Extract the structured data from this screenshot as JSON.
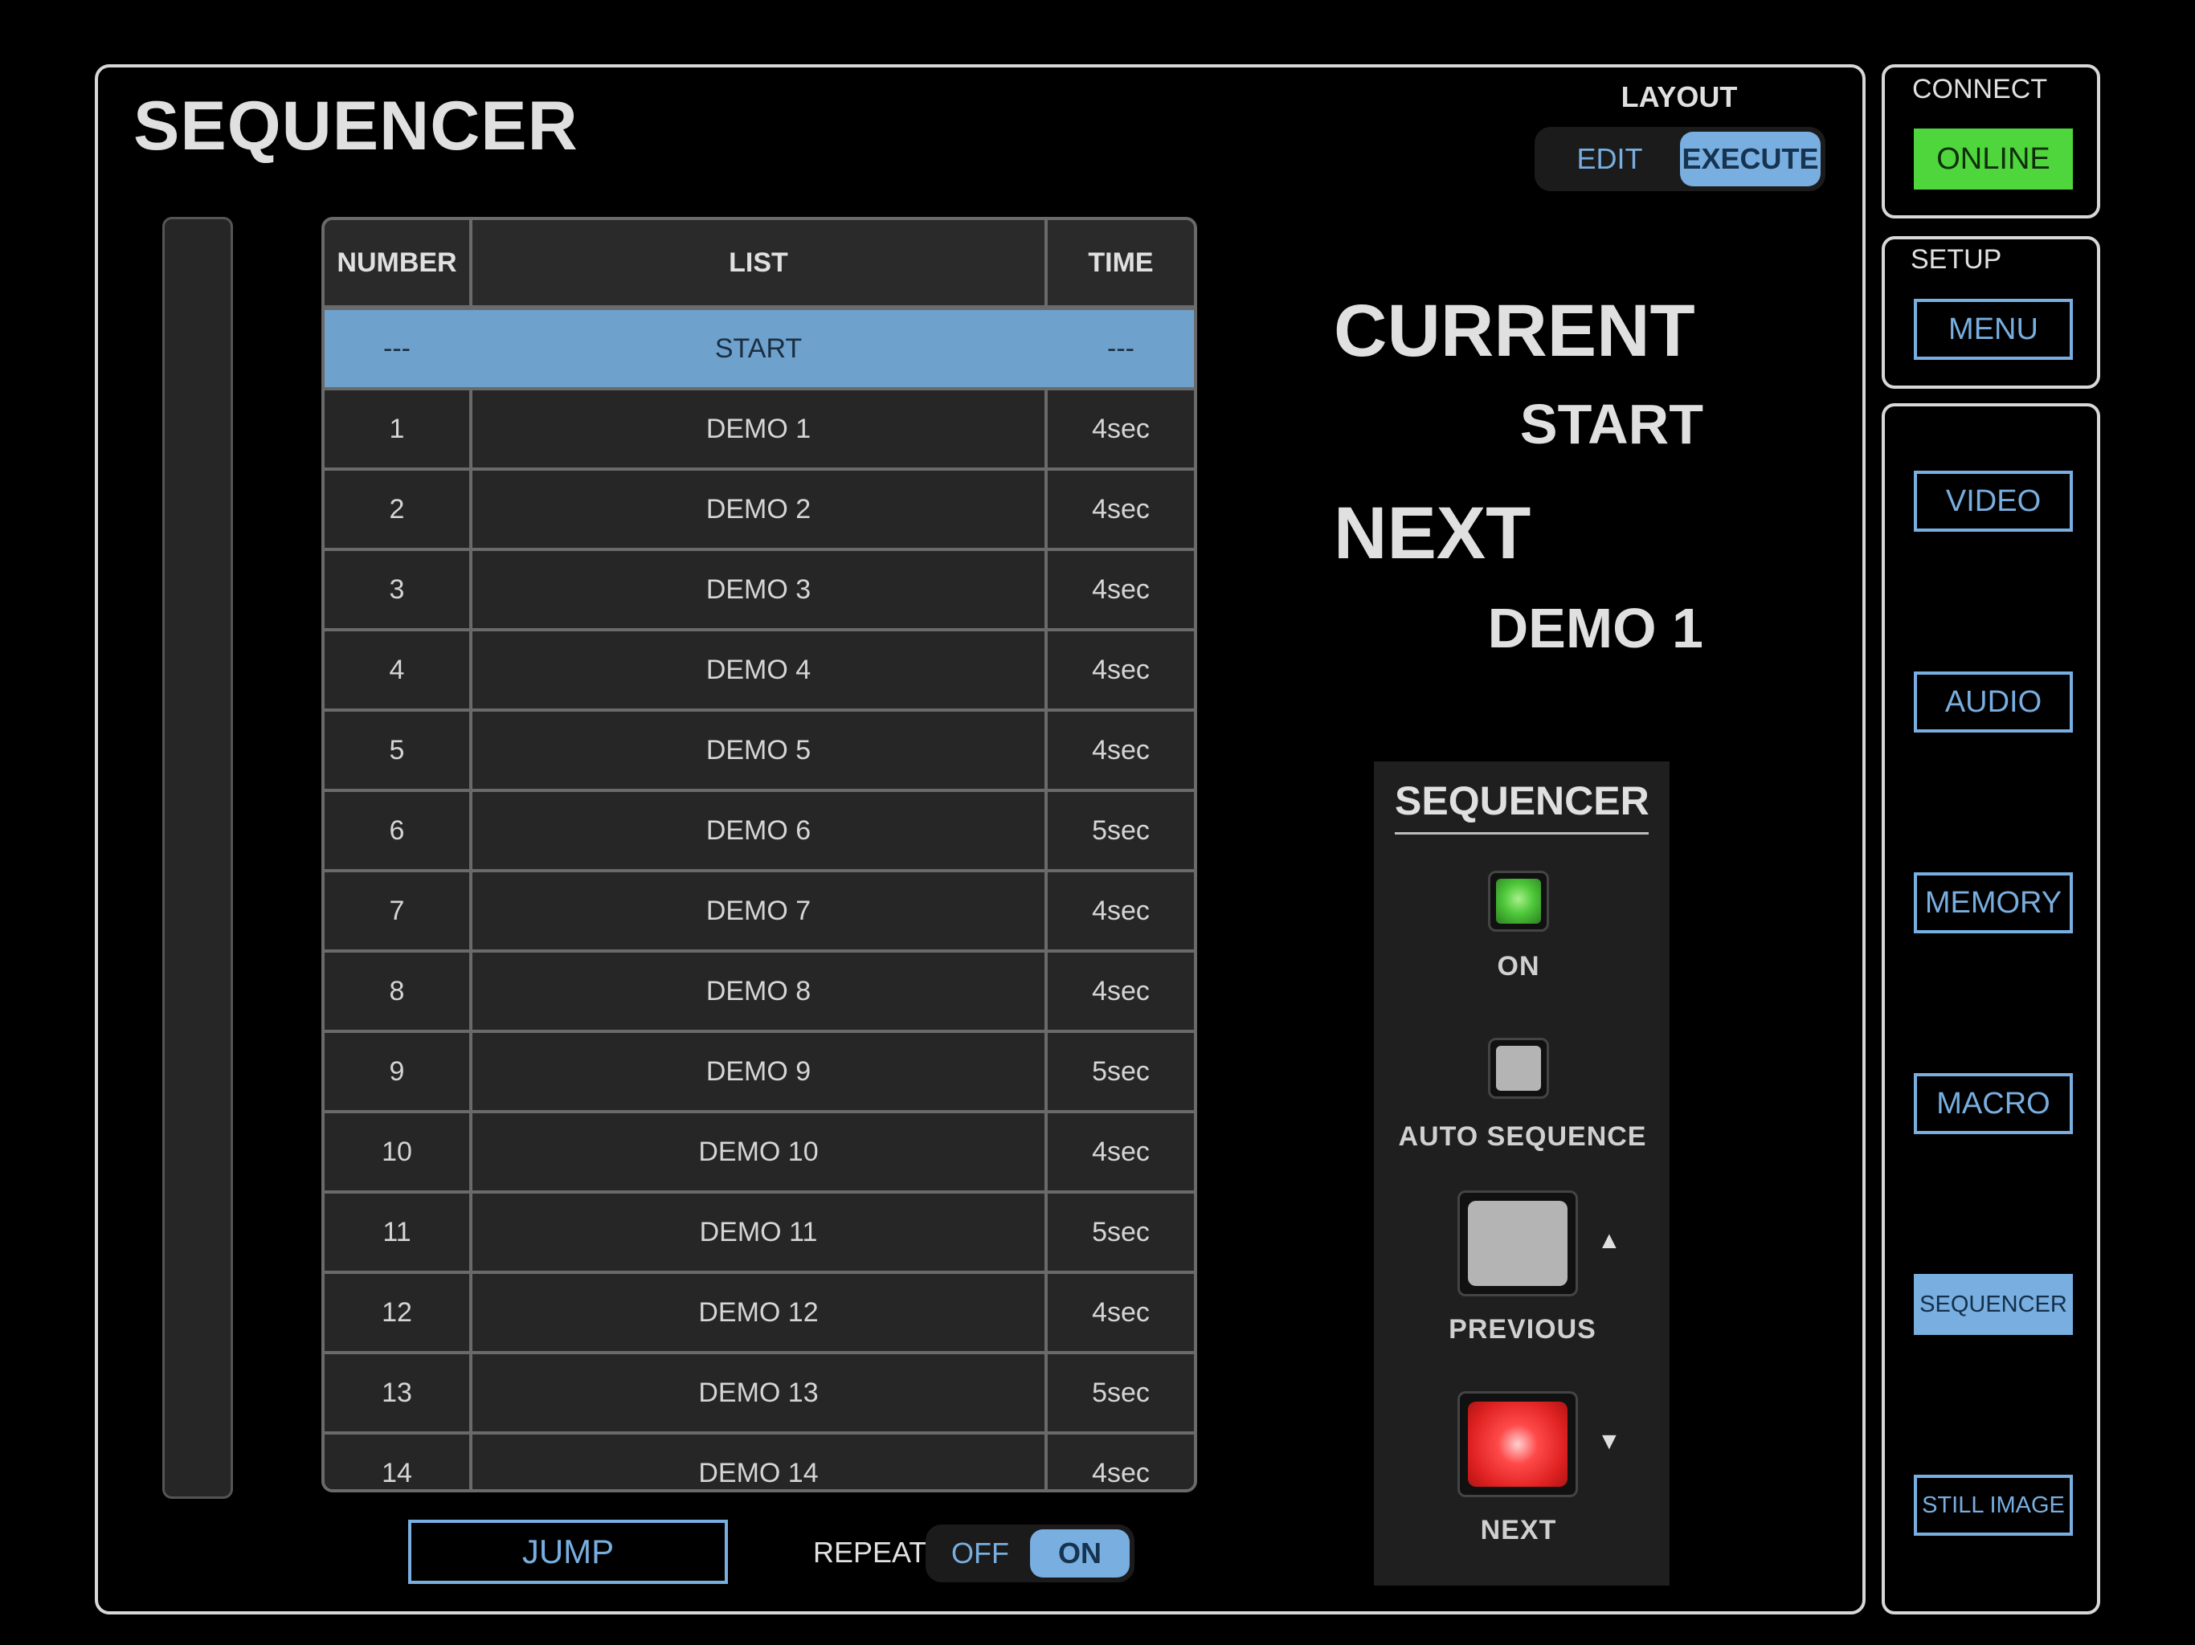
{
  "page_title": "SEQUENCER",
  "layout": {
    "label": "LAYOUT",
    "options": [
      "EDIT",
      "EXECUTE"
    ],
    "selected": "EXECUTE"
  },
  "table": {
    "columns": [
      "NUMBER",
      "LIST",
      "TIME"
    ],
    "rows": [
      [
        "---",
        "START",
        "---"
      ],
      [
        "1",
        "DEMO 1",
        "4sec"
      ],
      [
        "2",
        "DEMO 2",
        "4sec"
      ],
      [
        "3",
        "DEMO 3",
        "4sec"
      ],
      [
        "4",
        "DEMO 4",
        "4sec"
      ],
      [
        "5",
        "DEMO 5",
        "4sec"
      ],
      [
        "6",
        "DEMO 6",
        "5sec"
      ],
      [
        "7",
        "DEMO 7",
        "4sec"
      ],
      [
        "8",
        "DEMO 8",
        "4sec"
      ],
      [
        "9",
        "DEMO 9",
        "5sec"
      ],
      [
        "10",
        "DEMO 10",
        "4sec"
      ],
      [
        "11",
        "DEMO 11",
        "5sec"
      ],
      [
        "12",
        "DEMO 12",
        "4sec"
      ],
      [
        "13",
        "DEMO 13",
        "5sec"
      ],
      [
        "14",
        "DEMO 14",
        "4sec"
      ]
    ],
    "selected_row": 0
  },
  "jump_label": "JUMP",
  "repeat": {
    "label": "REPEAT",
    "options": [
      "OFF",
      "ON"
    ],
    "selected": "ON"
  },
  "current": {
    "heading": "CURRENT",
    "value": "START"
  },
  "next": {
    "heading": "NEXT",
    "value": "DEMO 1"
  },
  "sequencer_panel": {
    "title": "SEQUENCER",
    "on_label": "ON",
    "auto_label": "AUTO SEQUENCE",
    "previous_label": "PREVIOUS",
    "next_label": "NEXT",
    "previous_arrow": "▲",
    "next_arrow": "▼"
  },
  "sidebar": {
    "connect_label": "CONNECT",
    "online_label": "ONLINE",
    "setup_label": "SETUP",
    "menu_label": "MENU",
    "nav": [
      "VIDEO",
      "AUDIO",
      "MEMORY",
      "MACRO",
      "SEQUENCER",
      "STILL IMAGE"
    ],
    "active_nav": "SEQUENCER"
  },
  "colors": {
    "accent": "#78aee0",
    "selected_row": "#6ea1cc",
    "online_green": "#4ed63c",
    "on_lamp_green": "#4ec83a",
    "next_red": "#e02222"
  }
}
